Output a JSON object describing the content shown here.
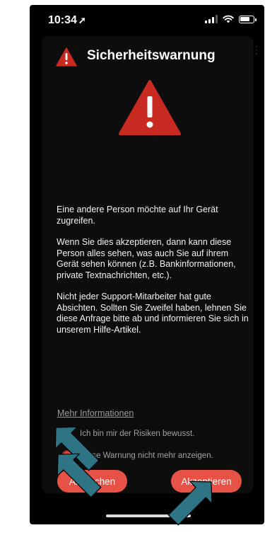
{
  "status_bar": {
    "time": "10:34",
    "location_arrow": "location-arrow-icon"
  },
  "dialog": {
    "title": "Sicherheitswarnung",
    "paragraphs": [
      "Eine andere Person möchte auf Ihr Gerät zugreifen.",
      "Wenn Sie dies akzeptieren, dann kann diese Person alles sehen, was auch Sie auf ihrem Gerät sehen können (z.B. Bankinformationen, private Textnachrichten, etc.).",
      "Nicht jeder Support-Mitarbeiter hat gute Absichten. Sollten Sie Zweifel haben, lehnen Sie diese Anfrage bitte ab und informieren Sie sich in unserem Hilfe-Artikel."
    ],
    "more_info_link": "Mehr Informationen",
    "checkboxes": [
      {
        "label": "Ich bin mir der Risiken bewusst."
      },
      {
        "label": "Diese Warnung nicht mehr anzeigen."
      }
    ],
    "cancel_button": "Abbrechen",
    "accept_button": "Akzeptieren"
  },
  "colors": {
    "accent": "#e85246",
    "warning_red": "#c82a21",
    "annotation_arrow": "#2e7484",
    "background": "#000000"
  },
  "battery_level": 0.8,
  "icons": [
    "warning-triangle-icon",
    "signal-icon",
    "wifi-icon",
    "battery-icon",
    "kebab-menu-icon"
  ]
}
